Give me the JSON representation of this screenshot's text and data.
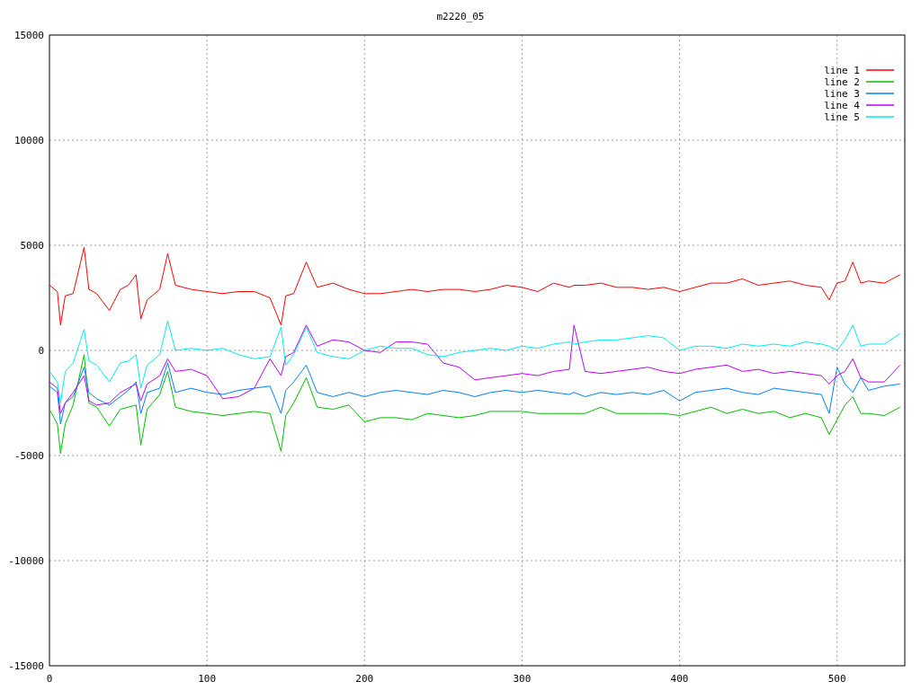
{
  "chart_data": {
    "type": "line",
    "title": "m2220_05",
    "grid": true,
    "legend": true,
    "xlim": [
      0,
      543
    ],
    "ylim": [
      -15000,
      15000
    ],
    "xticks": [
      0,
      100,
      200,
      300,
      400,
      500
    ],
    "yticks": [
      -15000,
      -10000,
      -5000,
      0,
      5000,
      10000,
      15000
    ],
    "x": [
      0,
      5,
      7,
      10,
      15,
      22,
      25,
      30,
      38,
      45,
      50,
      55,
      58,
      62,
      70,
      75,
      80,
      90,
      100,
      110,
      120,
      130,
      140,
      147,
      150,
      155,
      163,
      170,
      180,
      190,
      200,
      210,
      220,
      230,
      240,
      250,
      260,
      270,
      280,
      290,
      300,
      310,
      320,
      330,
      333,
      340,
      350,
      360,
      370,
      380,
      390,
      400,
      410,
      420,
      430,
      440,
      450,
      460,
      470,
      480,
      490,
      495,
      500,
      505,
      510,
      515,
      520,
      530,
      540
    ],
    "series": [
      {
        "name": "line 1",
        "color": "#ff0000",
        "values": [
          3100,
          2800,
          1200,
          2600,
          2700,
          4900,
          2900,
          2700,
          1900,
          2900,
          3100,
          3600,
          1500,
          2400,
          2900,
          4600,
          3100,
          2900,
          2800,
          2700,
          2800,
          2800,
          2500,
          1200,
          2600,
          2700,
          4200,
          3000,
          3200,
          2900,
          2700,
          2700,
          2800,
          2900,
          2800,
          2900,
          2900,
          2800,
          2900,
          3100,
          3000,
          2800,
          3200,
          3000,
          3100,
          3100,
          3200,
          3000,
          3000,
          2900,
          3000,
          2800,
          3000,
          3200,
          3200,
          3400,
          3100,
          3200,
          3300,
          3100,
          3000,
          2400,
          3200,
          3300,
          4200,
          3200,
          3300,
          3200,
          3600
        ]
      },
      {
        "name": "line 2",
        "color": "#00c000",
        "values": [
          -2800,
          -3500,
          -4900,
          -3500,
          -2600,
          -200,
          -2500,
          -2700,
          -3600,
          -2800,
          -2700,
          -2600,
          -4500,
          -2800,
          -2100,
          -1000,
          -2700,
          -2900,
          -3000,
          -3100,
          -3000,
          -2900,
          -3000,
          -4800,
          -3100,
          -2500,
          -1300,
          -2700,
          -2800,
          -2600,
          -3400,
          -3200,
          -3200,
          -3300,
          -3000,
          -3100,
          -3200,
          -3100,
          -2900,
          -2900,
          -2900,
          -3000,
          -3000,
          -3000,
          -3000,
          -3000,
          -2700,
          -3000,
          -3000,
          -3000,
          -3000,
          -3100,
          -2900,
          -2700,
          -3000,
          -2800,
          -3000,
          -2900,
          -3200,
          -3000,
          -3200,
          -4000,
          -3300,
          -2600,
          -2200,
          -3000,
          -3000,
          -3100,
          -2700
        ]
      },
      {
        "name": "line 3",
        "color": "#0080ff",
        "values": [
          -1700,
          -2000,
          -3500,
          -2500,
          -2200,
          -800,
          -2000,
          -2300,
          -2600,
          -2200,
          -1900,
          -1500,
          -3000,
          -2000,
          -1800,
          -600,
          -2000,
          -1800,
          -2000,
          -2100,
          -1900,
          -1800,
          -1700,
          -3000,
          -1900,
          -1500,
          -700,
          -2000,
          -2200,
          -2000,
          -2200,
          -2000,
          -1900,
          -2000,
          -2100,
          -1900,
          -2000,
          -2200,
          -2000,
          -1900,
          -2000,
          -1900,
          -2000,
          -2100,
          -2000,
          -2200,
          -2000,
          -2100,
          -2000,
          -2100,
          -1900,
          -2400,
          -2000,
          -1900,
          -1800,
          -2000,
          -2100,
          -1800,
          -1900,
          -2000,
          -2100,
          -3000,
          -800,
          -1600,
          -2000,
          -1300,
          -1900,
          -1700,
          -1600
        ]
      },
      {
        "name": "line 4",
        "color": "#c000ff",
        "values": [
          -1500,
          -1800,
          -3000,
          -2500,
          -2000,
          -1200,
          -2400,
          -2600,
          -2500,
          -2000,
          -1800,
          -1600,
          -2400,
          -1600,
          -1200,
          -400,
          -1000,
          -900,
          -1200,
          -2300,
          -2200,
          -1800,
          -400,
          -1200,
          -300,
          -100,
          1200,
          200,
          500,
          400,
          0,
          -100,
          400,
          400,
          300,
          -600,
          -800,
          -1400,
          -1300,
          -1200,
          -1100,
          -1200,
          -1000,
          -900,
          1200,
          -1000,
          -1100,
          -1000,
          -900,
          -800,
          -1000,
          -1100,
          -900,
          -800,
          -700,
          -1000,
          -900,
          -1100,
          -1000,
          -1100,
          -1200,
          -1600,
          -1200,
          -1000,
          -400,
          -1300,
          -1500,
          -1500,
          -700
        ]
      },
      {
        "name": "line 5",
        "color": "#00eeee",
        "values": [
          -1000,
          -1500,
          -2500,
          -1000,
          -600,
          1000,
          -500,
          -700,
          -1500,
          -600,
          -500,
          -200,
          -1800,
          -700,
          -200,
          1400,
          0,
          100,
          0,
          100,
          -200,
          -400,
          -300,
          1100,
          -700,
          -200,
          1100,
          -100,
          -300,
          -400,
          0,
          200,
          100,
          100,
          -200,
          -300,
          -100,
          0,
          100,
          0,
          200,
          100,
          300,
          400,
          300,
          400,
          500,
          500,
          600,
          700,
          600,
          0,
          200,
          200,
          100,
          300,
          200,
          300,
          200,
          400,
          300,
          200,
          0,
          500,
          1200,
          200,
          300,
          300,
          800
        ]
      }
    ]
  }
}
